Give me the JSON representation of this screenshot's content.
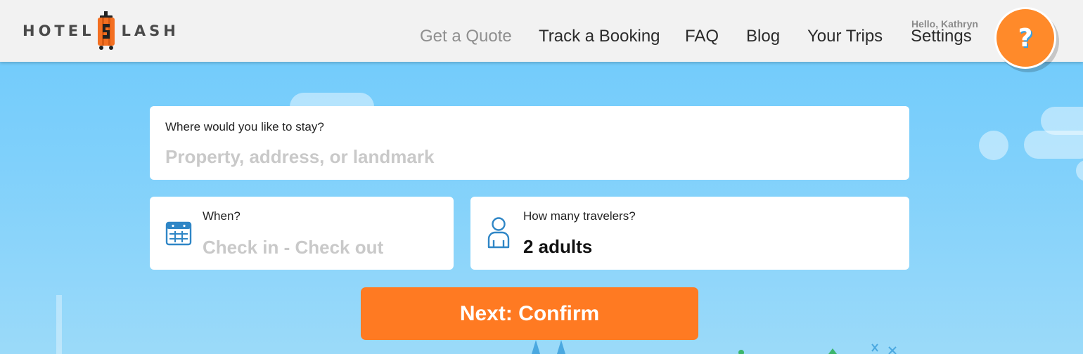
{
  "brand": {
    "left_word": "HOTEL",
    "right_word": "LASH",
    "colors": {
      "primary": "#ff7a22",
      "sky": "#6cc9fb",
      "header_bg": "#f2f2f2"
    }
  },
  "nav": {
    "items": [
      {
        "label": "Get a Quote",
        "active": true
      },
      {
        "label": "Track a Booking"
      },
      {
        "label": "FAQ"
      },
      {
        "label": "Blog"
      },
      {
        "label": "Your Trips"
      },
      {
        "label": "Settings"
      }
    ],
    "greeting": "Hello, Kathryn",
    "help_button": {
      "label": "?",
      "icon": "question-mark-icon"
    }
  },
  "form": {
    "destination": {
      "label": "Where would you like to stay?",
      "placeholder": "Property, address, or landmark",
      "value": ""
    },
    "dates": {
      "label": "When?",
      "placeholder": "Check in - Check out",
      "value": "",
      "icon": "calendar-icon"
    },
    "travelers": {
      "label": "How many travelers?",
      "value": "2 adults",
      "icon": "person-icon"
    },
    "submit_label": "Next: Confirm"
  }
}
